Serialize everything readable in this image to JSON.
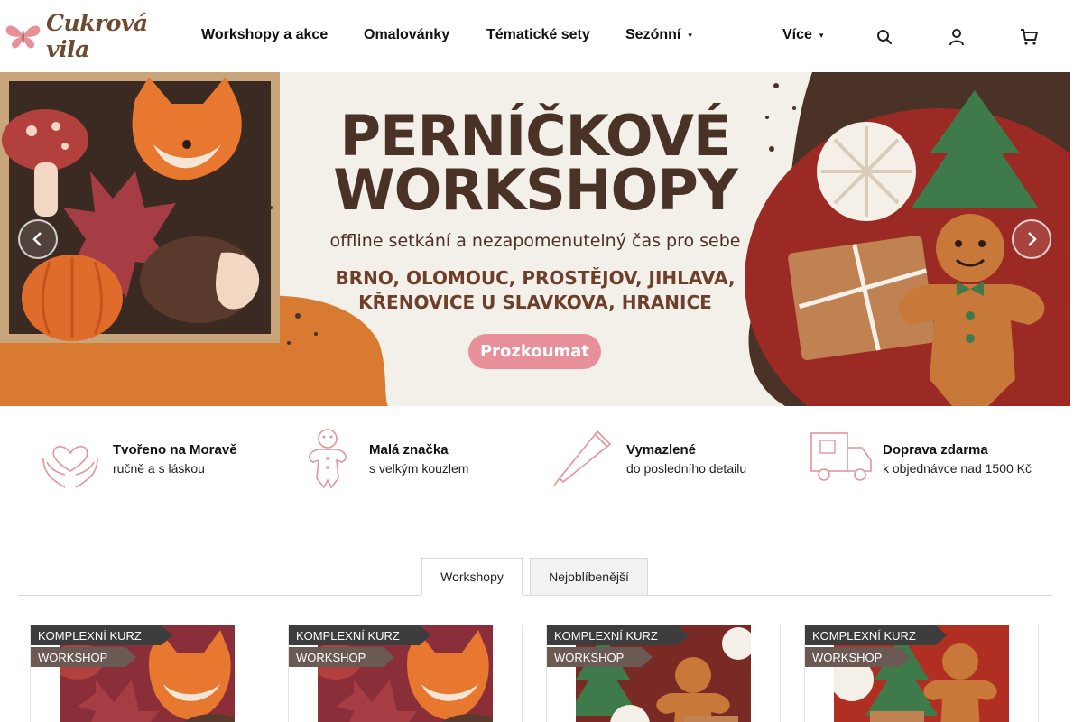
{
  "brand": {
    "name": "Cukrová vila",
    "logo_icon": "butterfly-icon"
  },
  "nav": {
    "items": [
      {
        "label": "Workshopy a akce"
      },
      {
        "label": "Omalovánky"
      },
      {
        "label": "Tématické sety"
      },
      {
        "label": "Sezónní",
        "caret": "▾"
      },
      {
        "label": "Více",
        "caret": "▾"
      }
    ],
    "icons": [
      "search-icon",
      "user-icon",
      "cart-icon"
    ]
  },
  "hero": {
    "title_line1": "PERNÍČKOVÉ",
    "title_line2": "WORKSHOPY",
    "subtitle": "offline setkání a nezapomenutelný čas pro sebe",
    "cities_line1": "BRNO, OLOMOUC, PROSTĚJOV, JIHLAVA,",
    "cities_line2": "KŘENOVICE U SLAVKOVA, HRANICE",
    "cta_label": "Prozkoumat",
    "prev_icon": "chevron-left-icon",
    "next_icon": "chevron-right-icon",
    "colors": {
      "accent_orange": "#d97a32",
      "brown": "#4a3227",
      "cta_pink": "#e8909a"
    }
  },
  "benefits": [
    {
      "title": "Tvořeno na Moravě",
      "subtitle": "ručně a s láskou",
      "icon": "heart-hands-icon"
    },
    {
      "title": "Malá značka",
      "subtitle": "s velkým kouzlem",
      "icon": "gingerbread-man-icon"
    },
    {
      "title": "Vymazlené",
      "subtitle": "do posledního detailu",
      "icon": "piping-bag-icon"
    },
    {
      "title": "Doprava zdarma",
      "subtitle": "k objednávce nad 1500 Kč",
      "icon": "delivery-truck-icon"
    }
  ],
  "tabs": [
    {
      "label": "Workshopy",
      "active": true
    },
    {
      "label": "Nejoblíbenější",
      "active": false
    }
  ],
  "products": [
    {
      "badge1": "KOMPLEXNÍ KURZ",
      "badge2": "WORKSHOP",
      "image": "autumn-cookies"
    },
    {
      "badge1": "KOMPLEXNÍ KURZ",
      "badge2": "WORKSHOP",
      "image": "autumn-cookies"
    },
    {
      "badge1": "KOMPLEXNÍ KURZ",
      "badge2": "WORKSHOP",
      "image": "christmas-cookies"
    },
    {
      "badge1": "KOMPLEXNÍ KURZ",
      "badge2": "WORKSHOP",
      "image": "christmas-cookies"
    }
  ]
}
